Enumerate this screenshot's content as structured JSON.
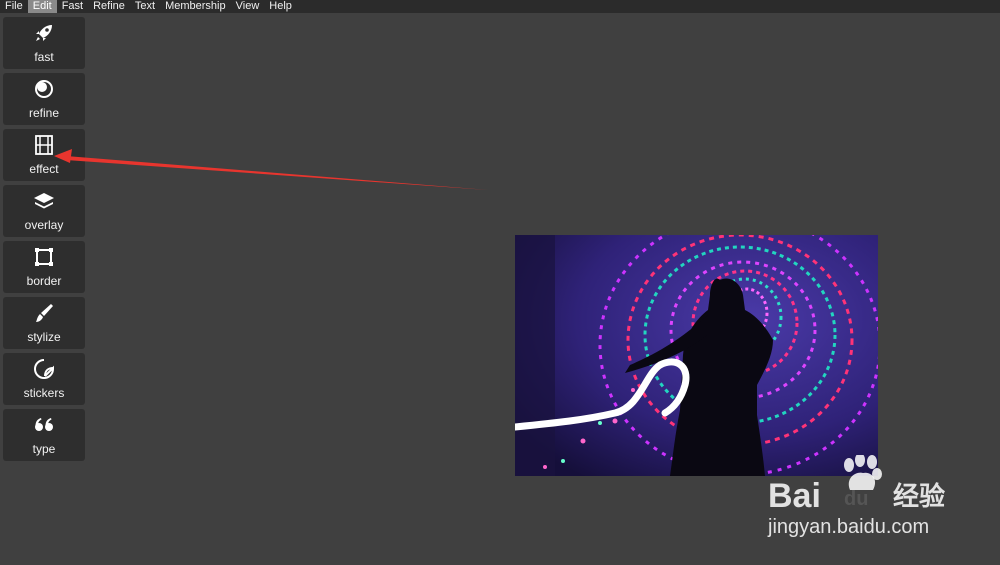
{
  "menu": {
    "items": [
      {
        "label": "File"
      },
      {
        "label": "Edit"
      },
      {
        "label": "Fast"
      },
      {
        "label": "Refine"
      },
      {
        "label": "Text"
      },
      {
        "label": "Membership"
      },
      {
        "label": "View"
      },
      {
        "label": "Help"
      }
    ],
    "active_index": 1
  },
  "toolbar": {
    "tools": [
      {
        "label": "fast",
        "icon": "rocket-icon"
      },
      {
        "label": "refine",
        "icon": "refine-icon"
      },
      {
        "label": "effect",
        "icon": "film-icon"
      },
      {
        "label": "overlay",
        "icon": "layers-icon"
      },
      {
        "label": "border",
        "icon": "border-frame-icon"
      },
      {
        "label": "stylize",
        "icon": "brush-icon"
      },
      {
        "label": "stickers",
        "icon": "sticker-icon"
      },
      {
        "label": "type",
        "icon": "quote-icon"
      }
    ]
  },
  "watermark": {
    "brand_text_1": "Bai",
    "brand_text_2": "du",
    "brand_cn": "经验",
    "url": "jingyan.baidu.com"
  },
  "colors": {
    "background": "#404040",
    "menubar": "#2b2b2b",
    "tool_bg": "#2e2e2e",
    "annotation_arrow": "#e8352e"
  }
}
